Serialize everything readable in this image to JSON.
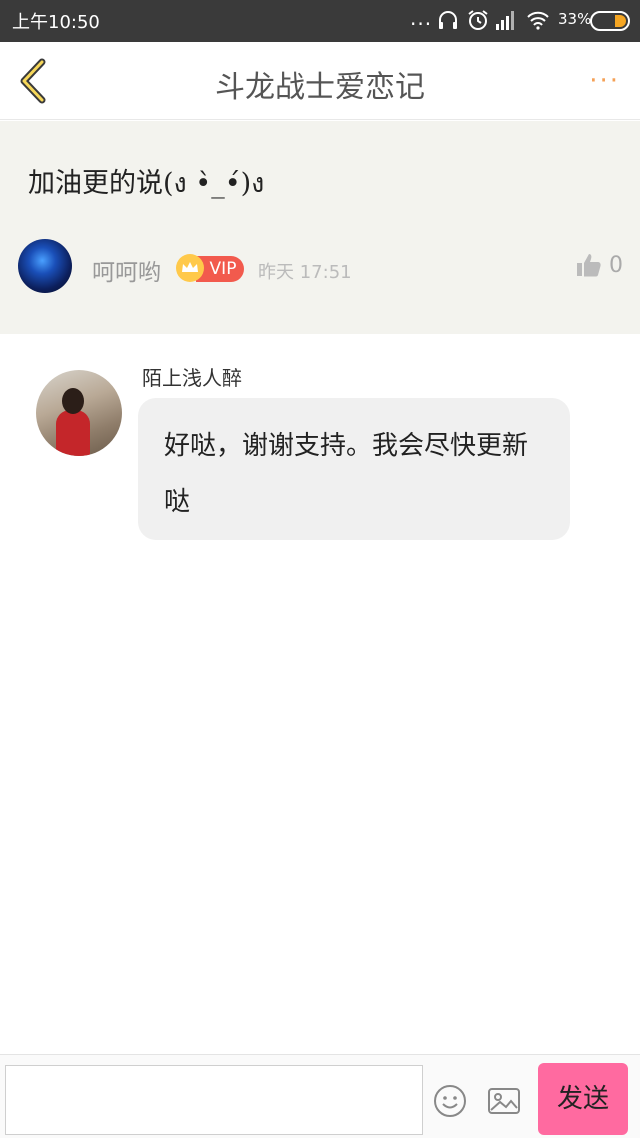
{
  "status_bar": {
    "time": "上午10:50",
    "dots": "...",
    "battery": "33%",
    "icons": [
      "headphones-icon",
      "alarm-icon",
      "signal-icon",
      "wifi-icon",
      "battery-icon"
    ]
  },
  "header": {
    "title": "斗龙战士爱恋记",
    "more": "···",
    "accent_color": "#f5a055"
  },
  "original_comment": {
    "text": "加油更的说(ง •̀_•́)ง",
    "user": "呵呵哟",
    "vip_badge": "VIP",
    "time": "昨天 17:51",
    "likes": "0"
  },
  "reply": {
    "author": "陌上浅人醉",
    "text": "好哒，谢谢支持。我会尽快更新哒"
  },
  "composer": {
    "placeholder": "",
    "send_label": "发送",
    "send_color": "#ff6aa0"
  }
}
